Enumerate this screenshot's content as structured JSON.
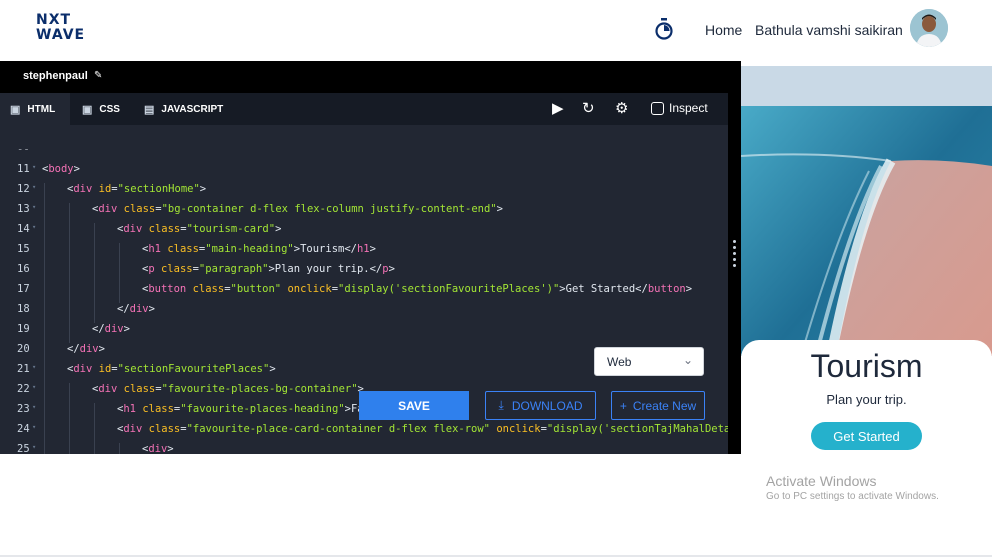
{
  "header": {
    "logo_line1": "NXT",
    "logo_line2": "WAVE",
    "nav_home": "Home",
    "user_name": "Bathula vamshi saikiran"
  },
  "editor": {
    "project_name": "stephenpaul",
    "tabs": [
      {
        "label": "HTML",
        "icon": "html5-icon",
        "active": true
      },
      {
        "label": "CSS",
        "icon": "css3-icon",
        "active": false
      },
      {
        "label": "JAVASCRIPT",
        "icon": "js-file-icon",
        "active": false
      }
    ],
    "tools": [
      "play-icon",
      "reset-icon",
      "settings-icon"
    ],
    "inspect_label": "Inspect",
    "lines": [
      {
        "n": "",
        "indent": 0,
        "parts": [
          [
            "t",
            "--"
          ]
        ]
      },
      {
        "n": "11",
        "fold": true,
        "indent": 0,
        "parts": [
          [
            "t",
            "<"
          ],
          [
            "g",
            "body"
          ],
          [
            "t",
            ">"
          ]
        ]
      },
      {
        "n": "12",
        "fold": true,
        "indent": 1,
        "parts": [
          [
            "t",
            "<"
          ],
          [
            "g",
            "div"
          ],
          [
            "t",
            " "
          ],
          [
            "a",
            "id"
          ],
          [
            "t",
            "="
          ],
          [
            "s",
            "\"sectionHome\""
          ],
          [
            "t",
            ">"
          ]
        ]
      },
      {
        "n": "13",
        "fold": true,
        "indent": 2,
        "parts": [
          [
            "t",
            "<"
          ],
          [
            "g",
            "div"
          ],
          [
            "t",
            " "
          ],
          [
            "a",
            "class"
          ],
          [
            "t",
            "="
          ],
          [
            "s",
            "\"bg-container d-flex flex-column justify-content-end\""
          ],
          [
            "t",
            ">"
          ]
        ]
      },
      {
        "n": "14",
        "fold": true,
        "indent": 3,
        "parts": [
          [
            "t",
            "<"
          ],
          [
            "g",
            "div"
          ],
          [
            "t",
            " "
          ],
          [
            "a",
            "class"
          ],
          [
            "t",
            "="
          ],
          [
            "s",
            "\"tourism-card\""
          ],
          [
            "t",
            ">"
          ]
        ]
      },
      {
        "n": "15",
        "indent": 4,
        "parts": [
          [
            "t",
            "<"
          ],
          [
            "g",
            "h1"
          ],
          [
            "t",
            " "
          ],
          [
            "a",
            "class"
          ],
          [
            "t",
            "="
          ],
          [
            "s",
            "\"main-heading\""
          ],
          [
            "t",
            ">Tourism</"
          ],
          [
            "g",
            "h1"
          ],
          [
            "t",
            ">"
          ]
        ]
      },
      {
        "n": "16",
        "indent": 4,
        "parts": [
          [
            "t",
            "<"
          ],
          [
            "g",
            "p"
          ],
          [
            "t",
            " "
          ],
          [
            "a",
            "class"
          ],
          [
            "t",
            "="
          ],
          [
            "s",
            "\"paragraph\""
          ],
          [
            "t",
            ">Plan your trip.</"
          ],
          [
            "g",
            "p"
          ],
          [
            "t",
            ">"
          ]
        ]
      },
      {
        "n": "17",
        "indent": 4,
        "parts": [
          [
            "t",
            "<"
          ],
          [
            "g",
            "button"
          ],
          [
            "t",
            " "
          ],
          [
            "a",
            "class"
          ],
          [
            "t",
            "="
          ],
          [
            "s",
            "\"button\""
          ],
          [
            "t",
            " "
          ],
          [
            "a",
            "onclick"
          ],
          [
            "t",
            "="
          ],
          [
            "s",
            "\"display('sectionFavouritePlaces')\""
          ],
          [
            "t",
            ">Get Started</"
          ],
          [
            "g",
            "button"
          ],
          [
            "t",
            ">"
          ]
        ]
      },
      {
        "n": "18",
        "indent": 3,
        "parts": [
          [
            "t",
            "</"
          ],
          [
            "g",
            "div"
          ],
          [
            "t",
            ">"
          ]
        ]
      },
      {
        "n": "19",
        "indent": 2,
        "parts": [
          [
            "t",
            "</"
          ],
          [
            "g",
            "div"
          ],
          [
            "t",
            ">"
          ]
        ]
      },
      {
        "n": "20",
        "indent": 1,
        "parts": [
          [
            "t",
            "</"
          ],
          [
            "g",
            "div"
          ],
          [
            "t",
            ">"
          ]
        ]
      },
      {
        "n": "21",
        "fold": true,
        "indent": 1,
        "parts": [
          [
            "t",
            "<"
          ],
          [
            "g",
            "div"
          ],
          [
            "t",
            " "
          ],
          [
            "a",
            "id"
          ],
          [
            "t",
            "="
          ],
          [
            "s",
            "\"sectionFavouritePlaces\""
          ],
          [
            "t",
            ">"
          ]
        ]
      },
      {
        "n": "22",
        "fold": true,
        "indent": 2,
        "parts": [
          [
            "t",
            "<"
          ],
          [
            "g",
            "div"
          ],
          [
            "t",
            " "
          ],
          [
            "a",
            "class"
          ],
          [
            "t",
            "="
          ],
          [
            "s",
            "\"favourite-places-bg-container\""
          ],
          [
            "t",
            ">"
          ]
        ]
      },
      {
        "n": "23",
        "fold": true,
        "indent": 3,
        "parts": [
          [
            "t",
            "<"
          ],
          [
            "g",
            "h1"
          ],
          [
            "t",
            " "
          ],
          [
            "a",
            "class"
          ],
          [
            "t",
            "="
          ],
          [
            "s",
            "\"favourite-places-heading\""
          ],
          [
            "t",
            ">Fav"
          ]
        ]
      },
      {
        "n": "24",
        "fold": true,
        "indent": 3,
        "parts": [
          [
            "t",
            "<"
          ],
          [
            "g",
            "div"
          ],
          [
            "t",
            " "
          ],
          [
            "a",
            "class"
          ],
          [
            "t",
            "="
          ],
          [
            "s",
            "\"favourite-place-card-container d-flex flex-row\""
          ],
          [
            "t",
            " "
          ],
          [
            "a",
            "onclick"
          ],
          [
            "t",
            "="
          ],
          [
            "s",
            "\"display('sectionTajMahalDetai"
          ]
        ]
      },
      {
        "n": "25",
        "fold": true,
        "indent": 4,
        "parts": [
          [
            "t",
            "<"
          ],
          [
            "g",
            "div"
          ],
          [
            "t",
            ">"
          ]
        ]
      }
    ],
    "preview_select": "Web",
    "save_label": "SAVE",
    "download_label": "DOWNLOAD",
    "create_new_label": "Create New"
  },
  "preview": {
    "title": "Tourism",
    "subtitle": "Plan your trip.",
    "button_label": "Get Started"
  },
  "watermark": {
    "title": "Activate Windows",
    "subtitle": "Go to PC settings to activate Windows."
  },
  "colors": {
    "accent": "#2f80ed",
    "preview_button": "#25b1cc",
    "editor_bg": "#222733",
    "tag": "#f472b6",
    "attr": "#fbbf24",
    "string": "#a3e635"
  }
}
